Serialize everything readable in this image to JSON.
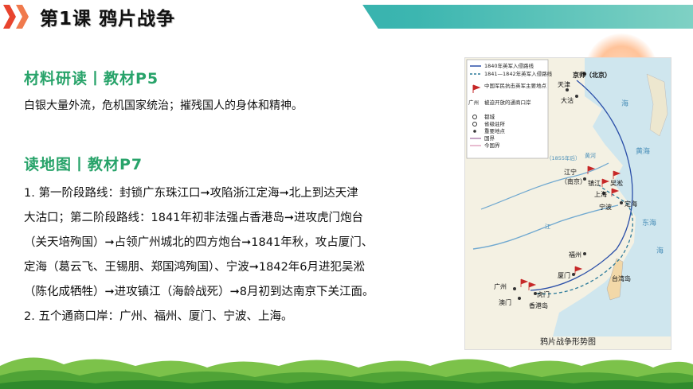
{
  "header": {
    "title": "第1课  鸦片战争"
  },
  "section1": {
    "title": "材料研读丨教材P5",
    "text": "白银大量外流，危机国家统治；摧残国人的身体和精神。"
  },
  "section2": {
    "title": "读地图丨教材P7",
    "lines": [
      "  1. 第一阶段路线：封锁广东珠江口➞攻陷浙江定海➞北上到达天津",
      "大沽口；第二阶段路线：1841年初非法强占香港岛➞进攻虎门炮台",
      "（关天培殉国）➞占领广州城北的四方炮台➞1841年秋，攻占厦门、",
      "定海（葛云飞、王锡朋、郑国鸿殉国）、宁波➞1842年6月进犯吴淞",
      "（陈化成牺牲）➞进攻镇江（海龄战死）➞8月初到达南京下关江面。",
      "  2. 五个通商口岸：广州、福州、厦门、宁波、上海。"
    ]
  },
  "map": {
    "caption": "鸦片战争形势图",
    "legend": [
      "1840年英军入侵路线",
      "1841—1842年英军入侵路线",
      "中国军民抗击英军主要地点",
      "广州",
      "被迫开放的通商口岸",
      "都城",
      "省级驻所",
      "重要地点",
      "国界",
      "今国界"
    ],
    "labels": {
      "capital": "京师（北京）",
      "tianjin": "天津",
      "dagu": "大沽",
      "jiangning": "江宁",
      "nanjing": "（南京）",
      "zhenjiang": "镇江",
      "wusong": "吴淞",
      "shanghai": "上海",
      "ningbo": "宁波",
      "dinghai": "定海",
      "fuzhou": "福州",
      "xiamen": "厦门",
      "guangzhou": "广州",
      "humen": "虎门",
      "macau": "澳门",
      "hongkong": "香港岛",
      "taiwan": "台湾岛",
      "yellow_sea": "黄海",
      "east_sea": "东海",
      "sea": "海",
      "bohai": "海",
      "yellow_river": "黄河",
      "river_note": "（1855年后）",
      "yangtze": "江"
    }
  }
}
